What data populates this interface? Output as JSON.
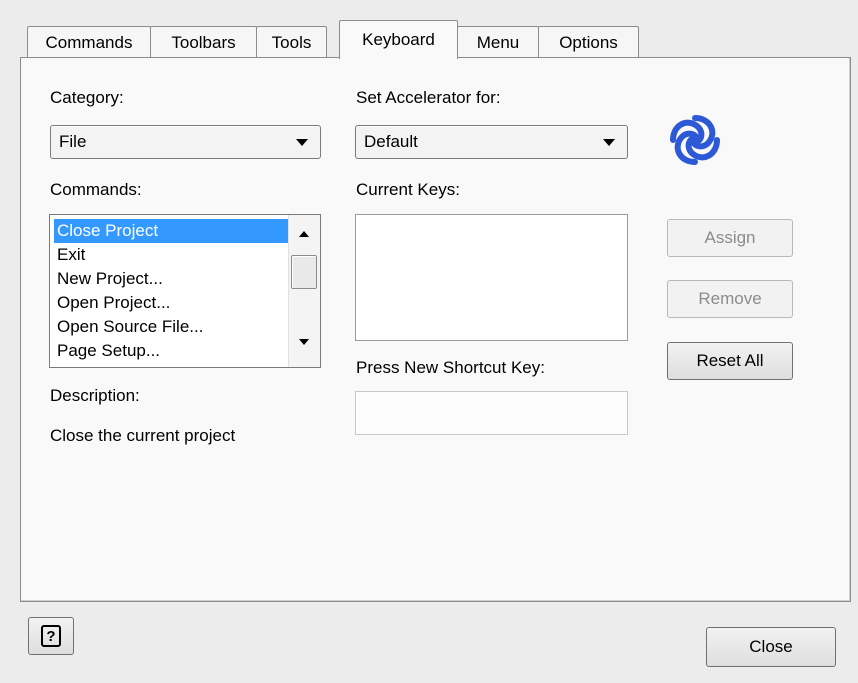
{
  "tabs": [
    {
      "label": "Commands"
    },
    {
      "label": "Toolbars"
    },
    {
      "label": "Tools"
    },
    {
      "label": "Keyboard"
    },
    {
      "label": "Menu"
    },
    {
      "label": "Options"
    }
  ],
  "active_tab": "Keyboard",
  "category": {
    "label": "Category:",
    "value": "File"
  },
  "accelerator": {
    "label": "Set Accelerator for:",
    "value": "Default"
  },
  "commands": {
    "label": "Commands:",
    "items": [
      {
        "label": "Close Project",
        "selected": true
      },
      {
        "label": "Exit"
      },
      {
        "label": "New Project..."
      },
      {
        "label": "Open Project..."
      },
      {
        "label": "Open Source File..."
      },
      {
        "label": "Page Setup..."
      }
    ]
  },
  "current_keys": {
    "label": "Current Keys:"
  },
  "new_shortcut": {
    "label": "Press New Shortcut Key:",
    "value": ""
  },
  "description": {
    "label": "Description:",
    "text": "Close the current project"
  },
  "buttons": {
    "assign": "Assign",
    "remove": "Remove",
    "reset_all": "Reset All",
    "close": "Close",
    "help": "?"
  },
  "colors": {
    "selection": "#3399ff",
    "logo_blue": "#2d58d6"
  },
  "icons": {
    "logo": "eclipse-swirl-icon",
    "help": "help-question-icon"
  }
}
